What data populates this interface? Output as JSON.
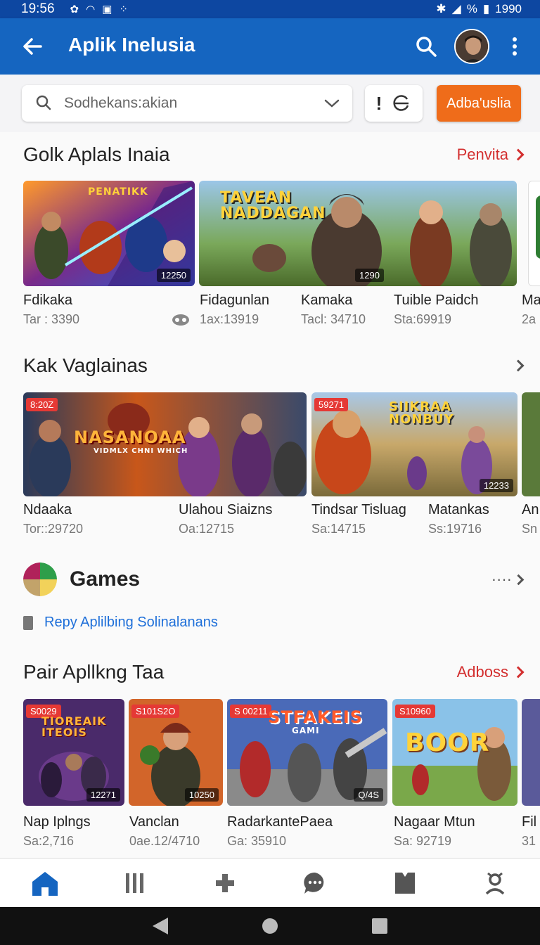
{
  "status_bar": {
    "time": "19:56",
    "battery": "1990",
    "percent": "%"
  },
  "app_bar": {
    "title": "Aplik Inelusia"
  },
  "search": {
    "placeholder": "Sodhekans:akian",
    "filter_label": "!",
    "primary_button": "Adba'uslia"
  },
  "section1": {
    "title": "Golk Aplals Inaia",
    "link": "Penvita",
    "cards": [
      {
        "art_title": "PENATIKK",
        "count": "12250"
      },
      {
        "art_title": "TAVEAN NADDAGAN",
        "count": "1290"
      }
    ],
    "items": [
      {
        "name": "Fdikaka",
        "sub": "Tar : 3390"
      },
      {
        "name": "Fidagunlan",
        "sub": "1ax:13919"
      },
      {
        "name": "Kamaka",
        "sub": "Tacl: 34710"
      },
      {
        "name": "Tuible Paidch",
        "sub": "Sta:69919"
      },
      {
        "name": "Ma",
        "sub": "2a"
      }
    ]
  },
  "section2": {
    "title": "Kak Vaglainas",
    "cards": [
      {
        "tag": "8:20Z",
        "art_title": "NASANOAA",
        "art_sub": "VIDMLX CHNI WHICH"
      },
      {
        "tag": "59271",
        "art_title": "SIIKRAA NONBUY",
        "count": "12233"
      }
    ],
    "items": [
      {
        "name": "Ndaaka",
        "sub": "Tor::29720"
      },
      {
        "name": "Ulahou Siaizns",
        "sub": "Oa:12715"
      },
      {
        "name": "Tindsar Tisluag",
        "sub": "Sa:14715"
      },
      {
        "name": "Matankas",
        "sub": "Ss:19716"
      },
      {
        "name": "An",
        "sub": "Sn"
      }
    ]
  },
  "games": {
    "title": "Games",
    "more": "····",
    "reply_text": "Repy Aplilbing Solinalanans"
  },
  "section3": {
    "title": "Pair Apllkng Taa",
    "link": "Adboss",
    "cards": [
      {
        "tag": "S0029",
        "art_title": "TIOREAIK ITEOIS",
        "count": "12271"
      },
      {
        "tag": "S101S2O",
        "count": "10250"
      },
      {
        "tag": "S 00211",
        "art_title": "STFAKEIS",
        "art_sub": "GAMI",
        "count": "Q/4S"
      },
      {
        "tag": "S10960",
        "art_title": "BOOR"
      }
    ],
    "items": [
      {
        "name": "Nap Iplngs",
        "sub": "Sa:2,716"
      },
      {
        "name": "Vanclan",
        "sub": "0ae.12/4710"
      },
      {
        "name": "RadarkantePaea",
        "sub": "Ga: 35910"
      },
      {
        "name": "Nagaar Mtun",
        "sub": "Sa: 92719"
      },
      {
        "name": "Fil",
        "sub": "31"
      }
    ]
  },
  "colors": {
    "app_bar": "#1565c0",
    "status_bar": "#0d47a1",
    "primary_button": "#ef6c1a",
    "link": "#d32f2f",
    "nav_active": "#1565c0"
  },
  "bottom_nav": [
    "home-icon",
    "library-icon",
    "gamepad-icon",
    "chat-icon",
    "bookmark-icon",
    "profile-icon"
  ]
}
